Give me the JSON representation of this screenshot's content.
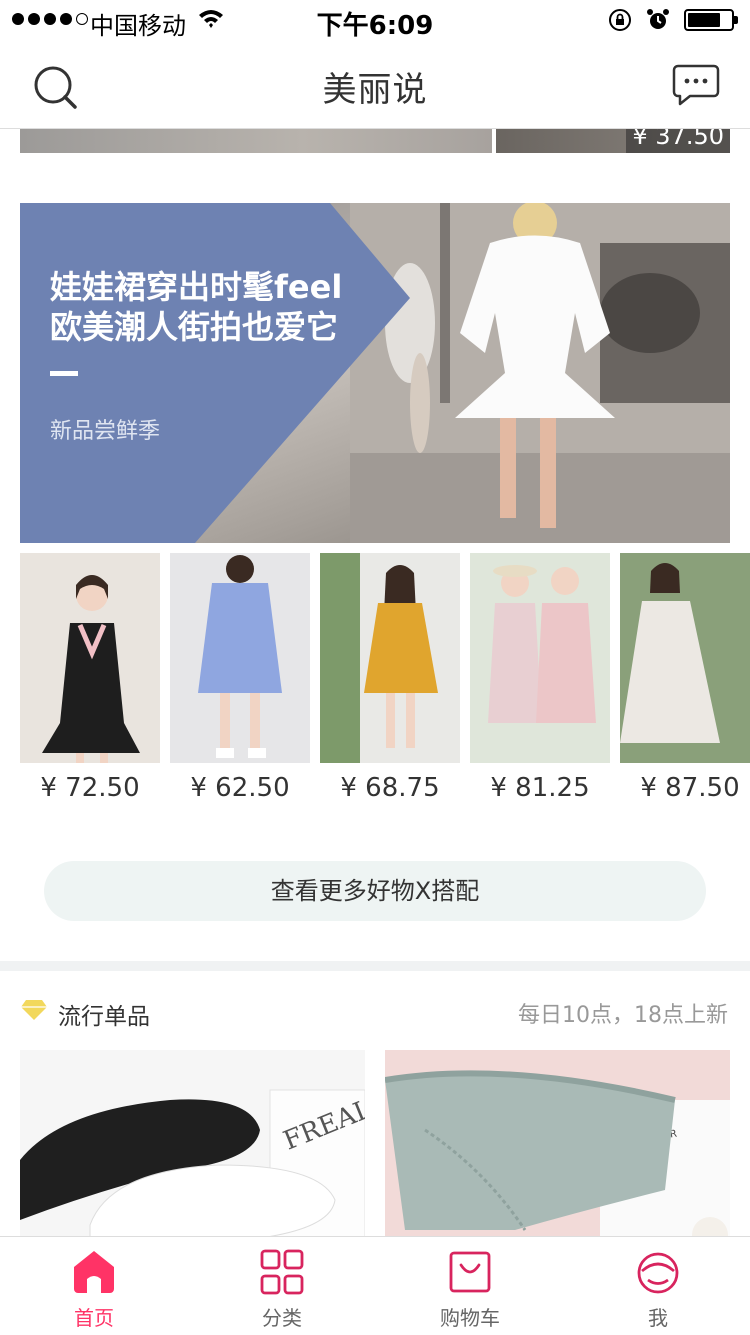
{
  "status_bar": {
    "carrier": "中国移动",
    "time": "下午6:09"
  },
  "nav": {
    "title": "美丽说",
    "search_icon": "search-icon",
    "message_icon": "message-icon"
  },
  "top_strip": {
    "price": "¥ 37.50"
  },
  "banner": {
    "line1": "娃娃裙穿出时髦feel",
    "line2": "欧美潮人街拍也爱它",
    "subtitle": "新品尝鲜季",
    "accent_color": "#6e82b2"
  },
  "products": [
    {
      "price": "¥ 72.50",
      "dress_color": "#1e1e1e"
    },
    {
      "price": "¥ 62.50",
      "dress_color": "#8fa6e0"
    },
    {
      "price": "¥ 68.75",
      "dress_color": "#e0a52e"
    },
    {
      "price": "¥ 81.25",
      "dress_color": "#ecc6c8"
    },
    {
      "price": "¥ 87.50",
      "dress_color": "#ece8e3"
    }
  ],
  "more_button": {
    "label": "查看更多好物X搭配"
  },
  "section": {
    "title": "流行单品",
    "note": "每日10点，18点上新",
    "icon": "diamond-icon",
    "icon_color": "#f2d85c"
  },
  "tabs": [
    {
      "label": "首页",
      "icon": "home-icon",
      "active": true
    },
    {
      "label": "分类",
      "icon": "category-grid-icon",
      "active": false
    },
    {
      "label": "购物车",
      "icon": "shopping-bag-icon",
      "active": false
    },
    {
      "label": "我",
      "icon": "profile-icon",
      "active": false
    }
  ],
  "colors": {
    "brand": "#ff3366",
    "more_button_bg": "#eef4f3"
  }
}
